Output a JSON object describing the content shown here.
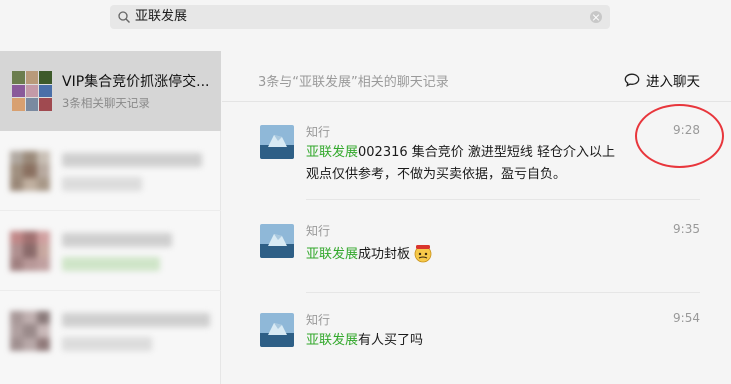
{
  "search": {
    "query": "亚联发展"
  },
  "sidebar": {
    "items": [
      {
        "title": "VIP集合竞价抓涨停交...",
        "subtitle": "3条相关聊天记录"
      }
    ]
  },
  "main": {
    "header": "3条与“亚联发展”相关的聊天记录",
    "enter_chat_label": "进入聊天",
    "messages": [
      {
        "sender": "知行",
        "time": "9:28",
        "keyword": "亚联发展",
        "text": "002316 集合竞价 激进型短线 轻仓介入以上观点仅供参考，不做为买卖依据，盈亏自负。"
      },
      {
        "sender": "知行",
        "time": "9:35",
        "keyword": "亚联发展",
        "text": "成功封板"
      },
      {
        "sender": "知行",
        "time": "9:54",
        "keyword": "亚联发展",
        "text": "有人买了吗"
      }
    ]
  },
  "colors": {
    "keyword": "#32a82b",
    "annotation_circle": "#e8363c",
    "active_item": "#d6d6d6"
  }
}
